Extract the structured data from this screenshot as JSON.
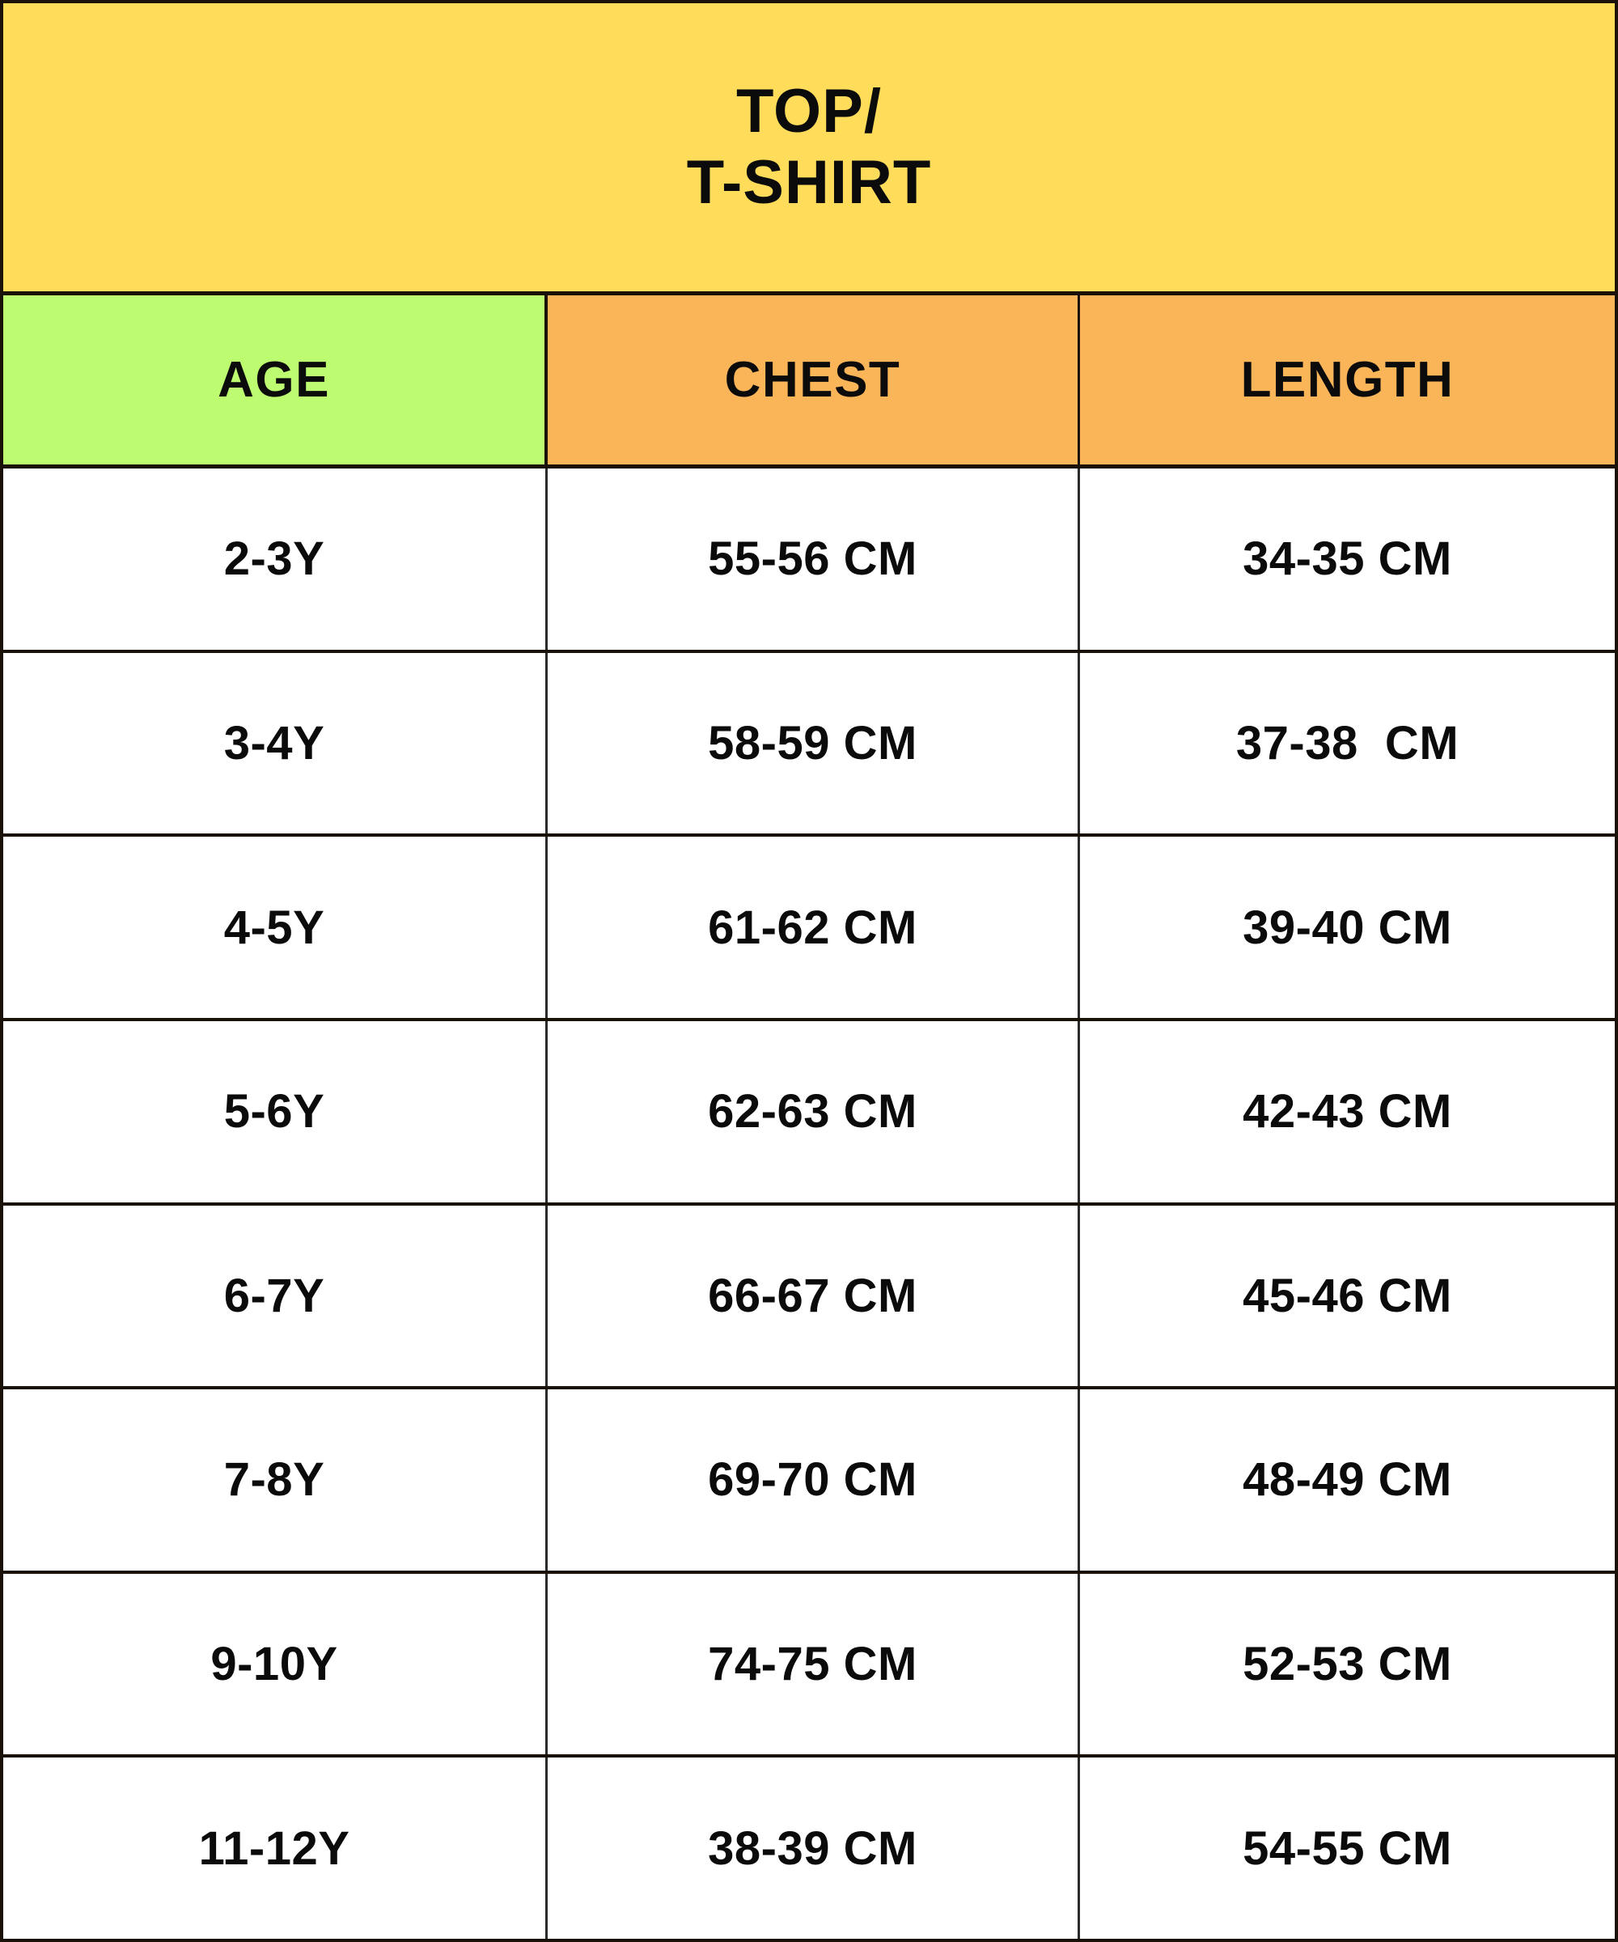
{
  "title": {
    "line1": "TOP/",
    "line2": "T-SHIRT"
  },
  "colors": {
    "title_bg": "#FFDC59",
    "age_header_bg": "#BDFC70",
    "measure_header_bg": "#FBB559",
    "cell_bg": "#FFFFFF",
    "border": "#1A1208",
    "text": "#0B0B0B"
  },
  "table": {
    "columns": [
      "AGE",
      "CHEST",
      "LENGTH"
    ],
    "rows": [
      {
        "age": "2-3Y",
        "chest": "55-56 CM",
        "length": "34-35 CM"
      },
      {
        "age": "3-4Y",
        "chest": "58-59 CM",
        "length": "37-38  CM"
      },
      {
        "age": "4-5Y",
        "chest": "61-62 CM",
        "length": "39-40 CM"
      },
      {
        "age": "5-6Y",
        "chest": "62-63 CM",
        "length": "42-43 CM"
      },
      {
        "age": "6-7Y",
        "chest": "66-67 CM",
        "length": "45-46 CM"
      },
      {
        "age": "7-8Y",
        "chest": "69-70 CM",
        "length": "48-49 CM"
      },
      {
        "age": "9-10Y",
        "chest": "74-75 CM",
        "length": "52-53 CM"
      },
      {
        "age": "11-12Y",
        "chest": "38-39 CM",
        "length": "54-55 CM"
      }
    ]
  },
  "chart_data": {
    "type": "table",
    "title": "TOP/ T-SHIRT",
    "columns": [
      "AGE",
      "CHEST",
      "LENGTH"
    ],
    "units": "CM",
    "rows": [
      [
        "2-3Y",
        "55-56 CM",
        "34-35 CM"
      ],
      [
        "3-4Y",
        "58-59 CM",
        "37-38  CM"
      ],
      [
        "4-5Y",
        "61-62 CM",
        "39-40 CM"
      ],
      [
        "5-6Y",
        "62-63 CM",
        "42-43 CM"
      ],
      [
        "6-7Y",
        "66-67 CM",
        "45-46 CM"
      ],
      [
        "7-8Y",
        "69-70 CM",
        "48-49 CM"
      ],
      [
        "9-10Y",
        "74-75 CM",
        "52-53 CM"
      ],
      [
        "11-12Y",
        "38-39 CM",
        "54-55 CM"
      ]
    ]
  }
}
